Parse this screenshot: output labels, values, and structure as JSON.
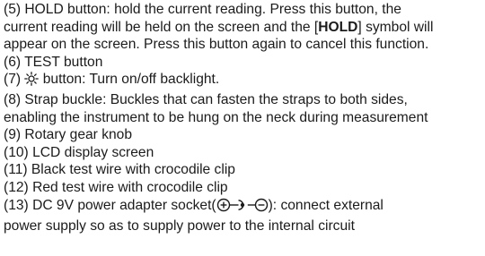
{
  "items": {
    "hold": {
      "lines": [
        "(5) HOLD button: hold the current reading. Press this button, the",
        "current reading will be held on the screen and the [",
        "] symbol will",
        "appear on the screen. Press this button again to cancel this function."
      ],
      "bold_word": "HOLD"
    },
    "test": "(6) TEST button",
    "backlight": {
      "prefix": "(7) ",
      "icon": "sun-icon",
      "text": "  button: Turn on/off backlight."
    },
    "strap": {
      "lines": [
        "(8) Strap buckle: Buckles that can fasten the straps to both sides,",
        "enabling the instrument to be hung on the neck during measurement"
      ]
    },
    "knob": "(9) Rotary gear knob",
    "lcd": "(10) LCD display screen",
    "black_wire": "(11) Black test wire with crocodile clip",
    "red_wire": "(12) Red test wire with crocodile clip",
    "power": {
      "prefix": "(13) DC 9V power adapter socket(",
      "icon": "dc-polarity-icon",
      "suffix": "): connect external",
      "line2": "power supply so as to supply power to the internal circuit"
    }
  }
}
